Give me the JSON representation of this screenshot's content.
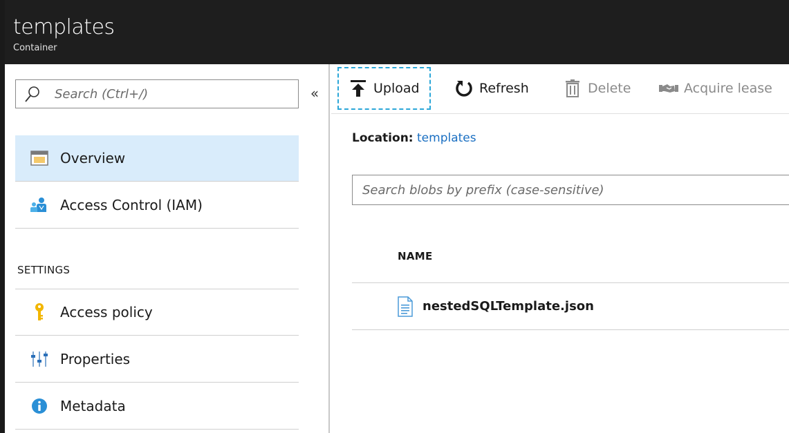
{
  "header": {
    "title": "templates",
    "subtitle": "Container"
  },
  "sidebar": {
    "search_placeholder": "Search (Ctrl+/)",
    "collapse_glyph": "«",
    "items": [
      {
        "label": "Overview",
        "icon": "overview-icon",
        "active": true
      },
      {
        "label": "Access Control (IAM)",
        "icon": "iam-users-icon"
      }
    ],
    "settings_header": "SETTINGS",
    "settings_items": [
      {
        "label": "Access policy",
        "icon": "key-icon"
      },
      {
        "label": "Properties",
        "icon": "properties-sliders-icon"
      },
      {
        "label": "Metadata",
        "icon": "info-icon"
      }
    ]
  },
  "toolbar": {
    "upload_label": "Upload",
    "refresh_label": "Refresh",
    "delete_label": "Delete",
    "acquire_lease_label": "Acquire lease"
  },
  "main": {
    "location_label": "Location:",
    "location_value": "templates",
    "blob_search_placeholder": "Search blobs by prefix (case-sensitive)",
    "table": {
      "columns": [
        "NAME"
      ],
      "rows": [
        {
          "name": "nestedSQLTemplate.json"
        }
      ]
    }
  },
  "colors": {
    "header_bg": "#1e1e1e",
    "active_item_bg": "#d9ecfb",
    "link": "#1a6fc2",
    "focus_dash": "#2aa6d8"
  }
}
